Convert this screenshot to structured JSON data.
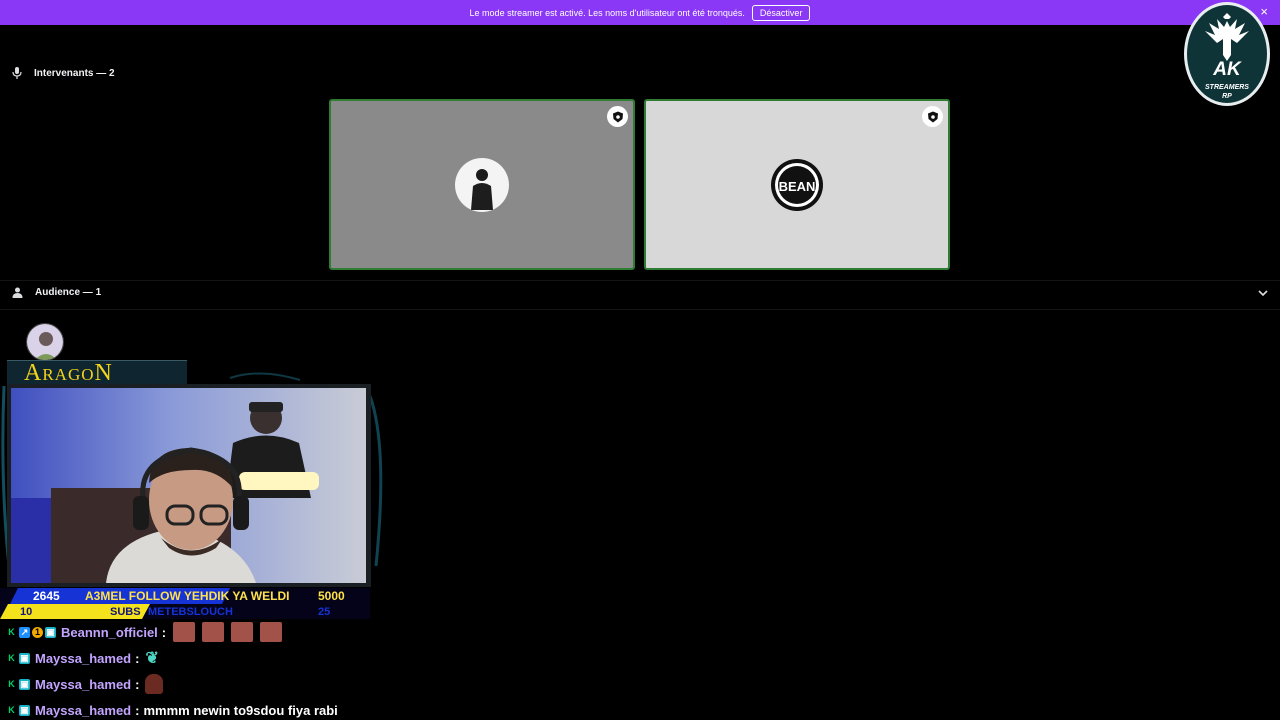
{
  "banner": {
    "text": "Le mode streamer est activé. Les noms d'utilisateur ont été tronqués.",
    "button": "Désactiver",
    "close": "×"
  },
  "speakers": {
    "header": "Intervenants — 2",
    "tiles": [
      {
        "bg": "#8a8a8a"
      },
      {
        "bg": "#d8d8d8",
        "avatar_text": "BEAN"
      }
    ]
  },
  "audience": {
    "header": "Audience — 1"
  },
  "overlay": {
    "logo": {
      "main": "AK",
      "sub1": "STREAMERS",
      "sub2": "RP"
    },
    "streamer_first": "A",
    "streamer_mid": "RAGO",
    "streamer_last": "N",
    "ticker": {
      "left_top": "2645",
      "message": "A3MEL FOLLOW YEHDIK YA WELDI",
      "right_top": "5000",
      "left_bottom": "10",
      "subs_label": "SUBS",
      "subs_name": "METEBSLOUCH",
      "right_bottom": "25"
    }
  },
  "chat": [
    {
      "user": "Beannn_officiel",
      "sep": ":",
      "text": ""
    },
    {
      "user": "Mayssa_hamed",
      "sep": ":",
      "text": ""
    },
    {
      "user": "Mayssa_hamed",
      "sep": ":",
      "text": ""
    },
    {
      "user": "Mayssa_hamed",
      "sep": ":",
      "text": "mmmm newin to9sdou fiya rabi"
    }
  ]
}
